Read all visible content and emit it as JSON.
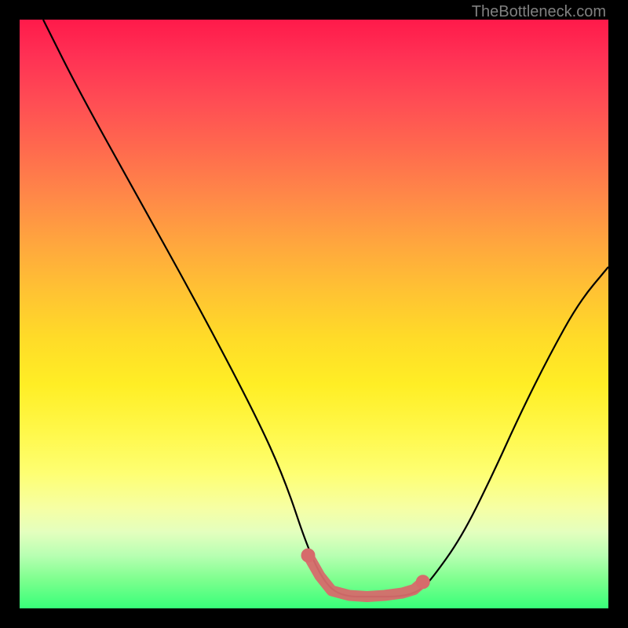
{
  "watermark": "TheBottleneck.com",
  "chart_data": {
    "type": "line",
    "title": "",
    "xlabel": "",
    "ylabel": "",
    "xlim": [
      0,
      100
    ],
    "ylim": [
      0,
      100
    ],
    "series": [
      {
        "name": "bottleneck-curve",
        "color": "#000000",
        "x": [
          4,
          10,
          20,
          30,
          40,
          45,
          49,
          52,
          55,
          60,
          65,
          68,
          70,
          75,
          80,
          85,
          90,
          95,
          100
        ],
        "y": [
          100,
          88,
          70,
          52,
          33,
          22,
          10,
          4,
          2,
          2,
          2,
          3,
          5,
          12,
          22,
          33,
          43,
          52,
          58
        ]
      }
    ],
    "highlight": {
      "name": "optimal-range",
      "color": "#d66b6b",
      "points_x": [
        49,
        51,
        53,
        56,
        59,
        62,
        65,
        67,
        68.5
      ],
      "points_y": [
        9,
        5.5,
        3,
        2.2,
        2.0,
        2.2,
        2.6,
        3.2,
        4.5
      ]
    }
  }
}
